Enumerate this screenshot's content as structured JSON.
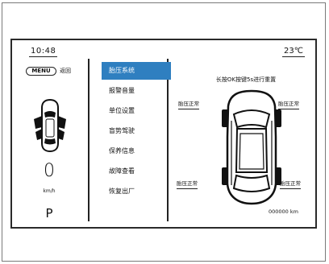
{
  "status_bar": {
    "time": "10:48",
    "temperature": "23℃"
  },
  "left_panel": {
    "menu_button": "MENU",
    "back_label": "返回",
    "speed": "0",
    "speed_unit": "km/h",
    "gear": "P"
  },
  "menu": {
    "items": [
      {
        "label": "胎压系统",
        "selected": true
      },
      {
        "label": "报警音量",
        "selected": false
      },
      {
        "label": "单位设置",
        "selected": false
      },
      {
        "label": "盲势驾驶",
        "selected": false
      },
      {
        "label": "保养信息",
        "selected": false
      },
      {
        "label": "故障查看",
        "selected": false
      },
      {
        "label": "恢复出厂",
        "selected": false
      }
    ]
  },
  "tire_panel": {
    "instruction": "长按OK按键5s进行重置",
    "front_left": "胎压正常",
    "front_right": "胎压正常",
    "rear_left": "胎压正常",
    "rear_right": "胎压正常",
    "mileage": "000000 km"
  },
  "colors": {
    "highlight": "#2f7fc0",
    "line": "#222222",
    "background": "#ffffff"
  }
}
